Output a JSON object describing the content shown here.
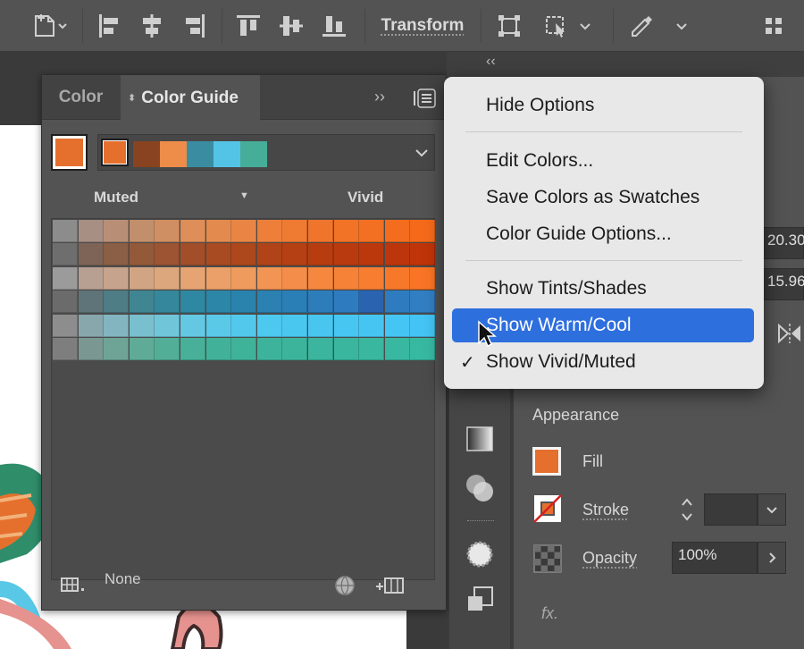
{
  "toolbar": {
    "transform_label": "Transform"
  },
  "panel": {
    "tabs": [
      {
        "label": "Color",
        "active": false
      },
      {
        "label": "Color Guide",
        "active": true
      }
    ],
    "collapse_glyph": "››",
    "current_color": "#e5702e",
    "harmony_colors": [
      "#e5702e",
      "#8a4320",
      "#ee8c4a",
      "#3a8da0",
      "#54c4e6",
      "#46ad98"
    ],
    "muted_label": "Muted",
    "vivid_label": "Vivid",
    "grid_rows": [
      [
        "#8c8c8c",
        "#a88f84",
        "#b88f76",
        "#c28f6c",
        "#d08f62",
        "#de8e58",
        "#e38a4e",
        "#e98544",
        "#ed7f3b",
        "#ef7a32",
        "#f0752c",
        "#f27226",
        "#f36f22",
        "#f46c1e",
        "#f56a1a"
      ],
      [
        "#6e6e6e",
        "#7d6456",
        "#8a5f45",
        "#935a3a",
        "#9c5432",
        "#a24f29",
        "#a84b22",
        "#ad471c",
        "#b14318",
        "#b44014",
        "#b73d11",
        "#b93a0f",
        "#bb380d",
        "#bd360b",
        "#bf3409"
      ],
      [
        "#9b9b9b",
        "#b79f92",
        "#c6a38c",
        "#d1a584",
        "#dca77c",
        "#e5a472",
        "#eaa068",
        "#ef9b5d",
        "#f29453",
        "#f48d49",
        "#f5873f",
        "#f68237",
        "#f77d30",
        "#f8782a",
        "#f97424"
      ],
      [
        "#6b6b6b",
        "#5e7478",
        "#4e7d86",
        "#408592",
        "#35889b",
        "#2f88a1",
        "#2c86a7",
        "#2a83ad",
        "#2a81b2",
        "#2b7fb7",
        "#2d7dbb",
        "#2f7bbf",
        "#2a63b0",
        "#2e7cbf",
        "#327ec2"
      ],
      [
        "#8d8d8d",
        "#88a7ad",
        "#82b5c0",
        "#7abfce",
        "#70c5d9",
        "#64c8e2",
        "#5ac9e8",
        "#52c9ec",
        "#4dc8ee",
        "#4ac7ef",
        "#48c6f0",
        "#47c6f1",
        "#46c5f2",
        "#45c5f3",
        "#44c4f4"
      ],
      [
        "#7e7e7e",
        "#7a9791",
        "#6ea496",
        "#5fab97",
        "#52ae97",
        "#48b098",
        "#42b199",
        "#3fb29a",
        "#3db39b",
        "#3cb49c",
        "#3bb59d",
        "#3ab69e",
        "#39b79f",
        "#38b8a0",
        "#37b9a1"
      ]
    ],
    "footer_label": "None"
  },
  "menu": {
    "items": [
      {
        "label": "Hide Options",
        "checked": false,
        "highlighted": false
      },
      {
        "label": "Edit Colors...",
        "checked": false,
        "highlighted": false
      },
      {
        "label": "Save Colors as Swatches",
        "checked": false,
        "highlighted": false
      },
      {
        "label": "Color Guide Options...",
        "checked": false,
        "highlighted": false
      },
      {
        "label": "Show Tints/Shades",
        "checked": false,
        "highlighted": false
      },
      {
        "label": "Show Warm/Cool",
        "checked": false,
        "highlighted": true
      },
      {
        "label": "Show Vivid/Muted",
        "checked": true,
        "highlighted": false
      }
    ],
    "check_glyph": "✓"
  },
  "properties": {
    "field_x_value": "20.30",
    "field_y_value": "15.96",
    "appearance_heading": "Appearance",
    "fill_label": "Fill",
    "fill_color": "#e5702e",
    "stroke_label": "Stroke",
    "opacity_label": "Opacity",
    "opacity_value": "100%",
    "fx_label": "fx."
  },
  "icons": [
    "new-document-icon",
    "align-left-icon",
    "align-horizontal-center-icon",
    "align-right-icon",
    "align-top-icon",
    "align-vertical-center-icon",
    "align-bottom-icon",
    "transform-bounds-icon",
    "puppet-warp-icon",
    "recolor-icon",
    "grid-icon",
    "panel-menu-icon",
    "swatch-library-icon",
    "globe-icon",
    "new-swatch-group-icon"
  ]
}
